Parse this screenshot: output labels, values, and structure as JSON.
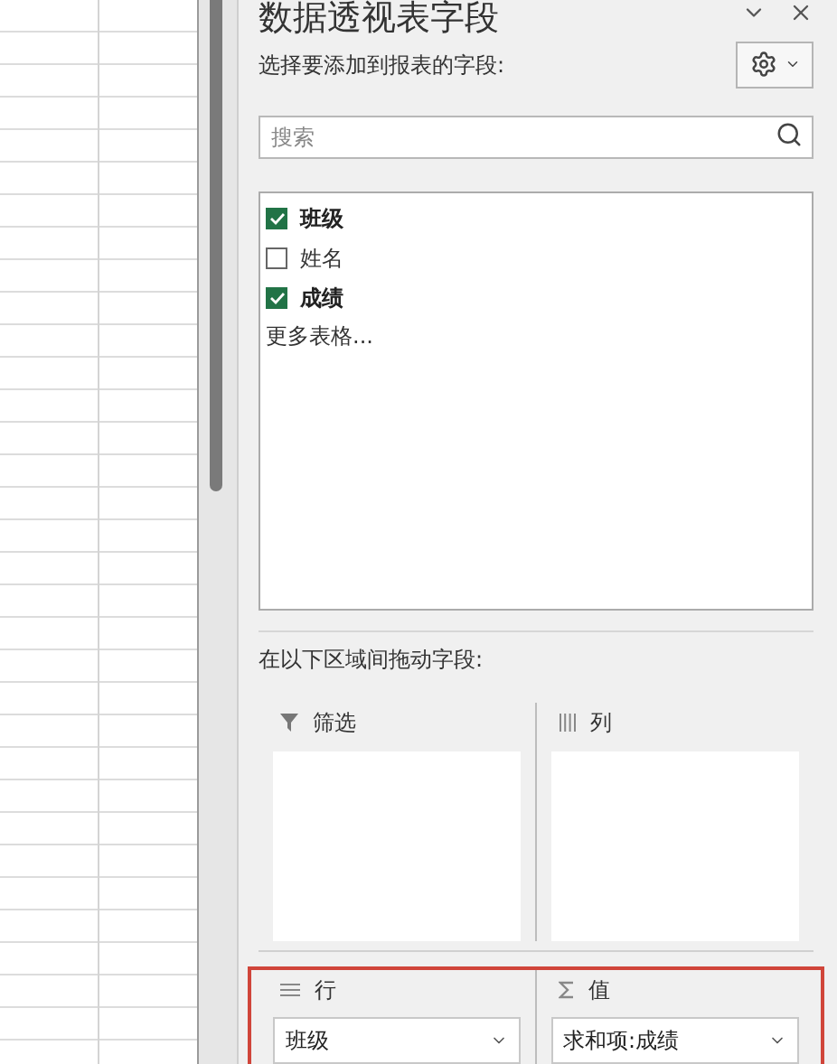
{
  "panel": {
    "title": "数据透视表字段",
    "prompt": "选择要添加到报表的字段:",
    "search": {
      "placeholder": "搜索"
    },
    "fields": [
      {
        "label": "班级",
        "checked": true
      },
      {
        "label": "姓名",
        "checked": false
      },
      {
        "label": "成绩",
        "checked": true
      }
    ],
    "more_tables": "更多表格...",
    "drag_hint": "在以下区域间拖动字段:",
    "top_areas": [
      {
        "kind": "filter",
        "label": "筛选"
      },
      {
        "kind": "columns",
        "label": "列"
      }
    ],
    "bottom_areas": {
      "highlighted": true,
      "areas": [
        {
          "kind": "rows",
          "label": "行",
          "items": [
            "班级"
          ]
        },
        {
          "kind": "values",
          "label": "值",
          "items": [
            "求和项:成绩"
          ]
        }
      ]
    }
  }
}
